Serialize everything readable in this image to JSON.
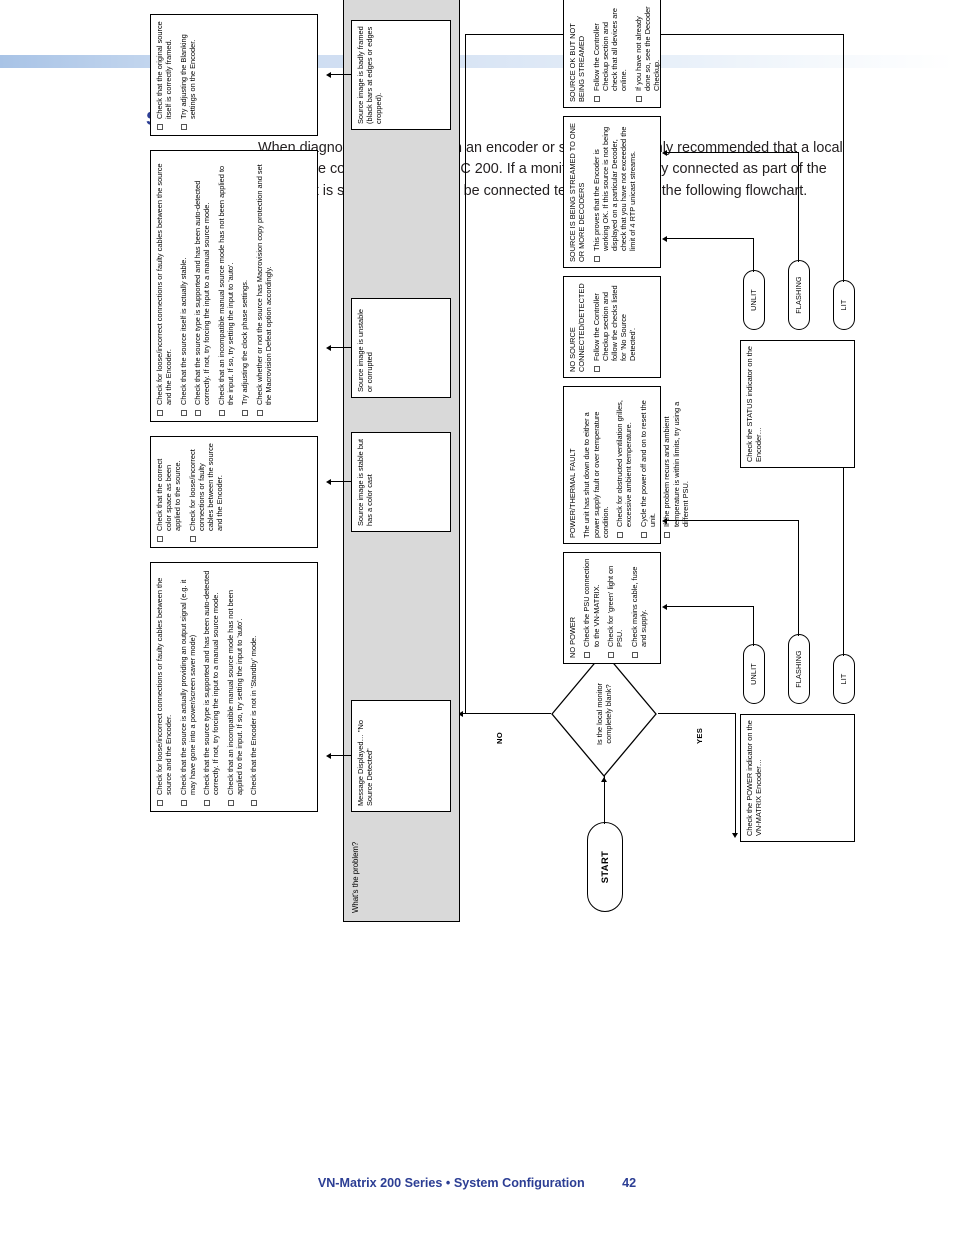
{
  "page": {
    "title": "Source Checkup",
    "intro": "When diagnosing problems with an encoder or source, it is highly recommended that a local monitor be connected to the VNC 200. If a monitor is not already connected as part of the system, it is suggested that one be connected temporarily. See the following flowchart."
  },
  "footer": {
    "text": "VN-Matrix 200 Series • System Configuration",
    "page_number": "42"
  },
  "flowchart": {
    "start_label": "START",
    "decision": {
      "text": "Is the local monitor completely blank?",
      "yes_label": "YES",
      "no_label": "NO"
    },
    "band_label": "What's the problem?",
    "power_branch": {
      "prompt": "Check the POWER indicator on the VN-MATRIX Encoder…",
      "states": [
        "UNLIT",
        "FLASHING",
        "LIT"
      ]
    },
    "status_branch": {
      "prompt": "Check the STATUS indicator on the Encoder…",
      "states": [
        "UNLIT",
        "FLASHING",
        "LIT"
      ]
    },
    "outcome_boxes": [
      {
        "id": "no-power",
        "heading": "NO POWER",
        "items": [
          "Check the PSU connection to the VN-MATRIX.",
          "Check for 'green' light on PSU.",
          "Check mains cable, fuse and supply."
        ]
      },
      {
        "id": "power-thermal-fault",
        "heading": "POWER/THERMAL FAULT",
        "lead": "The unit has shut down due to either a power supply fault or over temperature condition.",
        "items": [
          "Check for obstructed ventilation grilles, excessive ambient temperature.",
          "Cycle the power off and on to reset the unit.",
          "If the problem recurs and ambient temperature is within limits, try using a different PSU."
        ]
      },
      {
        "id": "no-source-connected",
        "heading": "NO SOURCE CONNECTED/DETECTED",
        "items": [
          "Follow the Controller Checkup section and follow the checks listed for 'No Source Detected'."
        ]
      },
      {
        "id": "source-streaming",
        "heading": "SOURCE IS BEING STREAMED TO ONE OR MORE DECODERS",
        "items": [
          "This proves that the Encoder is working OK. If this source is not being displayed on a particular Decoder, check that you have not exceeded the limit of 4 RTP unicast streams."
        ]
      },
      {
        "id": "source-ok-not-streamed",
        "heading": "SOURCE OK BUT NOT BEING STREAMED",
        "items": [
          "Follow the Controller Checkup section and check that all devices are online.",
          "If you have not already done so, see the Decoder Checkup."
        ]
      }
    ],
    "problems": [
      {
        "id": "no-source-detected",
        "text": "Message Displayed… \"No Source Detected\"",
        "checks": [
          "Check for loose/incorrect connections or faulty cables between the source and the Encoder.",
          "Check that the source is actually providing an output signal (e.g. it may have gone into a power/screen saver mode)",
          "Check that the source type is supported and has been auto-detected correctly. If not, try forcing the input to a manual source mode.",
          "Check that an incompatible manual source mode has not been applied to the input. If so, try setting the input to 'auto'.",
          "Check that the Encoder is not in 'Standby' mode."
        ]
      },
      {
        "id": "color-cast",
        "text": "Source image is stable but has a color cast",
        "checks": [
          "Check that the correct color space as been applied to the source.",
          "Check for loose/incorrect connections or faulty cables between the source and the Encoder."
        ]
      },
      {
        "id": "unstable-corrupted",
        "text": "Source image is unstable or corrupted",
        "checks": [
          "Check for loose/incorrect connections or faulty cables between the source and the Encoder.",
          "Check that the source itself is actually stable.",
          "Check that the source type is supported and has been auto-detected correctly. If not, try forcing the input to a manual source mode.",
          "Check that an incompatible manual source mode has not been applied to the input. If so, try setting the input to 'auto'.",
          "Try adjusting the clock phase settings.",
          "Check whether or not the source has Macrovision copy protection and set the Macrovision Defeat option accordingly."
        ]
      },
      {
        "id": "badly-framed",
        "text": "Source image is badly framed (black bars at edges or edges cropped).",
        "checks": [
          "Check that the original source itself is correctly framed.",
          "Try adjusting the Blanking settings on the Encoder."
        ]
      }
    ]
  }
}
